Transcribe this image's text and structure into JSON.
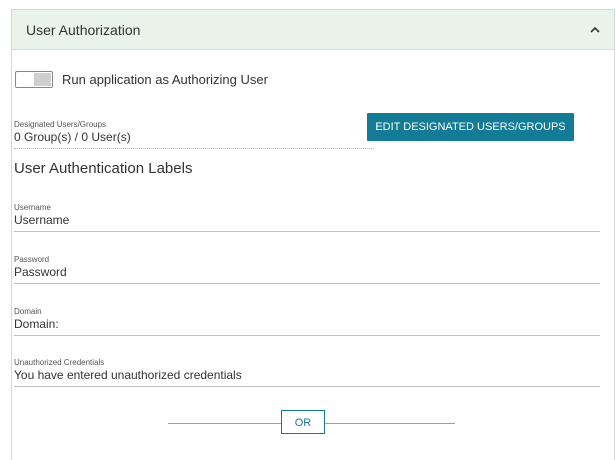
{
  "panel": {
    "title": "User Authorization",
    "collapse_icon": "chevron-up-icon"
  },
  "toggle": {
    "label": "Run application as Authorizing User",
    "on": false
  },
  "designated": {
    "label": "Designated Users/Groups",
    "value": "0 Group(s) / 0 User(s)",
    "edit_button": "EDIT DESIGNATED USERS/GROUPS"
  },
  "auth_labels": {
    "heading": "User Authentication Labels",
    "fields": [
      {
        "label": "Username",
        "value": "Username"
      },
      {
        "label": "Password",
        "value": "Password"
      },
      {
        "label": "Domain",
        "value": "Domain:"
      },
      {
        "label": "Unauthorized Credentials",
        "value": "You have entered unauthorized credentials"
      }
    ]
  },
  "divider": {
    "label": "OR"
  },
  "colors": {
    "header_bg": "#e8f3e9",
    "accent": "#137b96"
  }
}
